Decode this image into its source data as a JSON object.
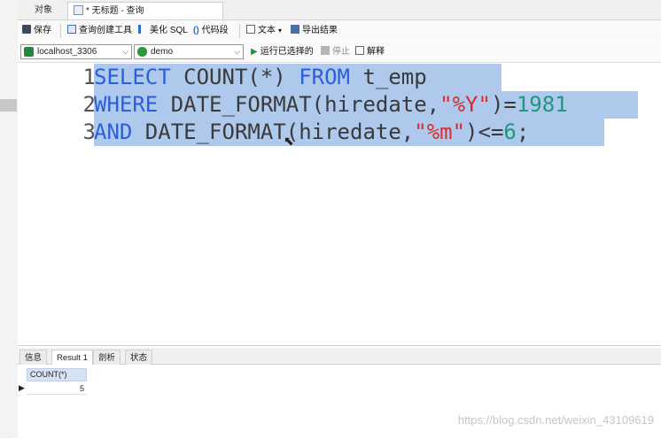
{
  "tabs": {
    "objects": "对象",
    "query": "* 无标题 - 查询"
  },
  "toolbar": {
    "save": "保存",
    "query_builder": "查询创建工具",
    "beautify_sql": "美化 SQL",
    "code_snippet": "代码段",
    "text": "文本",
    "export": "导出结果"
  },
  "connection": {
    "host": "localhost_3306",
    "database": "demo",
    "run_selected": "运行已选择的",
    "stop": "停止",
    "explain": "解释"
  },
  "editor": {
    "line_numbers": [
      "1",
      "2",
      "3"
    ],
    "line1": {
      "k1": "SELECT",
      "t1": " COUNT(*) ",
      "k2": "FROM",
      "t2": " t_emp"
    },
    "line2": {
      "k1": "WHERE",
      "t1": " DATE_FORMAT(hiredate,",
      "s1": "\"%Y\"",
      "t2": ")=",
      "n1": "1981"
    },
    "line3": {
      "k1": "AND",
      "t1": " DATE_FORMAT(hiredate,",
      "s1": "\"%m\"",
      "t2": ")<=",
      "n1": "6",
      "t3": ";"
    }
  },
  "results": {
    "tabs": [
      "信息",
      "Result 1",
      "剖析",
      "状态"
    ],
    "column": "COUNT(*)",
    "value": "5"
  },
  "watermark": "https://blog.csdn.net/weixin_43109619"
}
